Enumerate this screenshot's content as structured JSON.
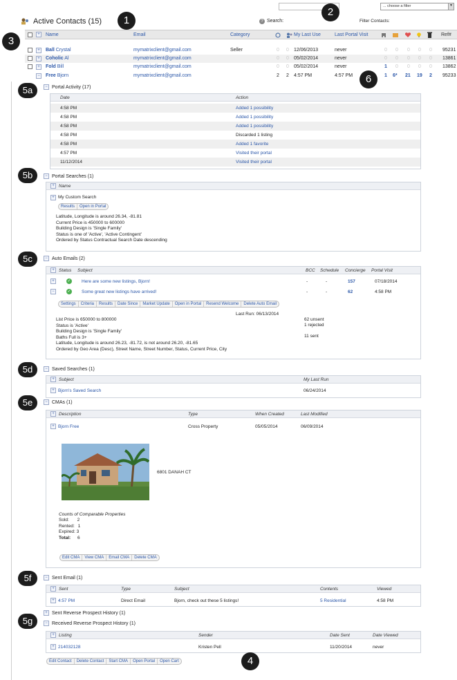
{
  "header": {
    "title": "Active Contacts (15)",
    "search_label": "Search:",
    "search_value": "",
    "filter_label": "Filter Contacts:",
    "filter_value": "... choose a filter"
  },
  "columns": {
    "name": "Name",
    "email": "Email",
    "category": "Category",
    "last_use": "My Last Use",
    "last_visit": "Last Portal Visit",
    "ref": "Ref#"
  },
  "contacts": [
    {
      "last": "Ball",
      "first": "Crystal",
      "email": "mymatrixclient@gmail.com",
      "category": "Seller",
      "c1": "0",
      "c2": "0",
      "last_use": "12/06/2013",
      "last_visit": "never",
      "n1": "0",
      "n2": "0",
      "n3": "0",
      "n4": "0",
      "n5": "0",
      "ref": "95231"
    },
    {
      "last": "Coholic",
      "first": "Al",
      "email": "mymatrixclient@gmail.com",
      "category": "",
      "c1": "0",
      "c2": "0",
      "last_use": "05/02/2014",
      "last_visit": "never",
      "n1": "0",
      "n2": "0",
      "n3": "0",
      "n4": "0",
      "n5": "0",
      "ref": "13861"
    },
    {
      "last": "Fold",
      "first": "Bill",
      "email": "mymatrixclient@gmail.com",
      "category": "",
      "c1": "0",
      "c2": "0",
      "last_use": "05/02/2014",
      "last_visit": "never",
      "n1": "1",
      "n2": "0",
      "n3": "0",
      "n4": "0",
      "n5": "0",
      "ref": "13862"
    },
    {
      "last": "Free",
      "first": "Bjorn",
      "email": "mymatrixclient@gmail.com",
      "category": "",
      "c1": "2",
      "c2": "2",
      "last_use": "4:57 PM",
      "last_visit": "4:57 PM",
      "n1": "1",
      "n2": "6*",
      "n3": "21",
      "n4": "19",
      "n5": "2",
      "ref": "95233"
    }
  ],
  "portal_activity": {
    "title": "Portal Activity (17)",
    "col_date": "Date",
    "col_action": "Action",
    "rows": [
      {
        "date": "4:58 PM",
        "action": "Added 1 possibility",
        "link": true
      },
      {
        "date": "4:58 PM",
        "action": "Added 1 possibility",
        "link": true
      },
      {
        "date": "4:58 PM",
        "action": "Added 1 possibility",
        "link": true
      },
      {
        "date": "4:58 PM",
        "action": "Discarded 1 listing",
        "link": false
      },
      {
        "date": "4:58 PM",
        "action": "Added 1 favorite",
        "link": true
      },
      {
        "date": "4:57 PM",
        "action": "Visited their portal",
        "link": true
      },
      {
        "date": "11/12/2014",
        "action": "Visited their portal",
        "link": true
      }
    ]
  },
  "portal_searches": {
    "title": "Portal Searches (1)",
    "col_name": "Name",
    "search_name": "My Custom Search",
    "btn_results": "Results",
    "btn_open": "Open in Portal",
    "lines": [
      "Latitude, Longitude is around 26.34, -81.81",
      "Current Price is 450000 to 600000",
      "Building Design is 'Single Family'",
      "Status is one of 'Active', 'Active Contingent'",
      "Ordered by Status Contractual Search Date descending"
    ]
  },
  "auto_emails": {
    "title": "Auto Emails (2)",
    "col_status": "Status",
    "col_subject": "Subject",
    "col_bcc": "BCC",
    "col_schedule": "Schedule",
    "col_concierge": "Concierge",
    "col_visit": "Portal Visit",
    "rows": [
      {
        "subject": "Here are some new listings, Bjorn!",
        "bcc": "-",
        "schedule": "-",
        "concierge": "157",
        "visit": "07/18/2014"
      },
      {
        "subject": "Some great new listings have arrived!",
        "bcc": "-",
        "schedule": "-",
        "concierge": "62",
        "visit": "4:58 PM"
      }
    ],
    "buttons": [
      "Settings",
      "Criteria",
      "Results",
      "Date Since",
      "Market Update",
      "Open in Portal",
      "Resend Welcome",
      "Delete Auto Email"
    ],
    "last_run": "Last Run: 06/13/2014",
    "unsent": "62 unsent",
    "rejected": "1 rejected",
    "sent": "11 sent",
    "lines": [
      "List Price is 650000 to 800000",
      "Status is 'Active'",
      "Building Design is 'Single Family'",
      "Baths Full is 3+",
      "Latitude, Longitude is around 26.23, -81.72, is not around 26.20, -81.65",
      "Ordered by Geo Area (Desc), Street Name, Street Number, Status, Current Price, City"
    ]
  },
  "saved_searches": {
    "title": "Saved Searches (1)",
    "col_subject": "Subject",
    "col_last_run": "My Last Run",
    "name": "Bjorn's Saved Search",
    "date": "06/24/2014"
  },
  "cmas": {
    "title": "CMAs (1)",
    "col_desc": "Description",
    "col_type": "Type",
    "col_created": "When Created",
    "col_modified": "Last Modified",
    "desc": "Bjorn Free",
    "type": "Cross Property",
    "created": "05/05/2014",
    "modified": "06/09/2014",
    "address": "6801 DANAH CT",
    "counts_title": "Counts of Comparable Properties",
    "sold": "Sold:",
    "sold_v": "2",
    "rented": "Rented:",
    "rented_v": "1",
    "expired": "Expired:",
    "expired_v": "3",
    "total": "Total:",
    "total_v": "6",
    "buttons": [
      "Edit CMA",
      "View CMA",
      "Email CMA",
      "Delete CMA"
    ]
  },
  "sent_email": {
    "title": "Sent Email (1)",
    "col_sent": "Sent",
    "col_type": "Type",
    "col_subject": "Subject",
    "col_contents": "Contents",
    "col_viewed": "Viewed",
    "sent": "4:57 PM",
    "type": "Direct Email",
    "subject": "Bjorn, check out these 5 listings!",
    "contents": "5 Residential",
    "viewed": "4:58 PM"
  },
  "reverse": {
    "sent_title": "Sent Reverse Prospect History (1)",
    "received_title": "Received Reverse Prospect History (1)",
    "col_listing": "Listing",
    "col_sender": "Sender",
    "col_date_sent": "Date Sent",
    "col_date_viewed": "Date Viewed",
    "listing": "214032128",
    "sender": "Kristen Pell",
    "date_sent": "11/20/2014",
    "date_viewed": "never"
  },
  "bottom_buttons": [
    "Edit Contact",
    "Delete Contact",
    "Start CMA",
    "Open Portal",
    "Open Cart"
  ],
  "badges": {
    "b1": "1",
    "b2": "2",
    "b3": "3",
    "b4": "4",
    "b5a": "5a",
    "b5b": "5b",
    "b5c": "5c",
    "b5d": "5d",
    "b5e": "5e",
    "b5f": "5f",
    "b5g": "5g",
    "b6": "6"
  }
}
